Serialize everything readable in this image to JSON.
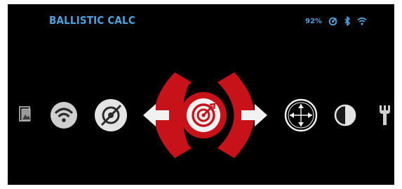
{
  "header": {
    "title": "BALLISTIC CALC",
    "battery": "92%"
  },
  "status_icons": [
    "ballistic-status-icon",
    "bluetooth-icon",
    "wifi-icon"
  ],
  "menu": {
    "items": [
      {
        "name": "gallery-icon",
        "selected": false
      },
      {
        "name": "wifi-settings-icon",
        "selected": false
      },
      {
        "name": "ballistic-off-icon",
        "selected": false
      },
      {
        "name": "ballistic-calc-icon",
        "selected": true
      },
      {
        "name": "reticle-icon",
        "selected": false
      },
      {
        "name": "brightness-icon",
        "selected": false
      },
      {
        "name": "tools-icon",
        "selected": false
      }
    ],
    "nav": [
      "arrow-left-icon",
      "arrow-right-icon"
    ]
  },
  "colors": {
    "background": "#000000",
    "accent_blue": "#4fa3dc",
    "selection_red": "#c8121a",
    "icon_gray": "#d8d8d8",
    "frame": "#ffffff"
  }
}
